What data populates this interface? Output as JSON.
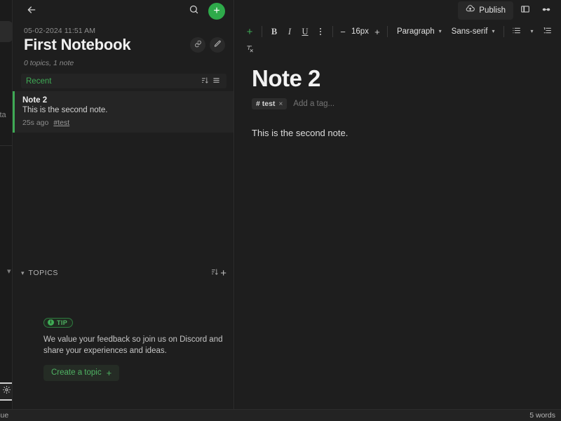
{
  "app_rail": {
    "beta_label": "Beta",
    "settings_icon": "gear-icon",
    "collapse_icon": "chevron-down-icon"
  },
  "list_panel": {
    "back_icon": "arrow-left-icon",
    "search_icon": "search-icon",
    "add_icon": "plus-icon",
    "notebook": {
      "date": "05-02-2024 11:51 AM",
      "title": "First Notebook",
      "meta": "0 topics, 1 note",
      "link_icon": "link-icon",
      "edit_icon": "pencil-icon"
    },
    "recent": {
      "label": "Recent",
      "sort_icon": "sort-descending-icon",
      "view_icon": "list-view-icon"
    },
    "notes": [
      {
        "title": "Note 2",
        "snippet": "This is the second note.",
        "age": "25s ago",
        "tag": "#test"
      }
    ],
    "topics": {
      "label": "TOPICS",
      "chevron_icon": "chevron-down-icon",
      "sort_icon": "sort-descending-icon",
      "add_icon": "plus-icon"
    },
    "tip": {
      "badge": "TIP",
      "badge_mark": "i",
      "text": "We value your feedback so join us on Discord and share your experiences and ideas.",
      "button_label": "Create a topic",
      "button_icon": "plus-icon"
    }
  },
  "editor": {
    "topbar": {
      "publish_label": "Publish",
      "publish_icon": "cloud-upload-icon",
      "split_view_icon": "split-view-icon",
      "reading_mode_icon": "glasses-icon"
    },
    "toolbar": {
      "insert_label": "+",
      "bold_label": "B",
      "italic_label": "I",
      "underline_label": "U",
      "more_icon": "more-vertical-icon",
      "size_decrease": "−",
      "size_value": "16px",
      "size_increase": "+",
      "block_type": "Paragraph",
      "font_family": "Sans-serif",
      "bullet_list_icon": "bulleted-list-icon",
      "list_caret_icon": "chevron-down-icon",
      "ordered_list_icon": "ordered-list-icon",
      "clear_format_icon": "clear-formatting-icon"
    },
    "document": {
      "title": "Note 2",
      "tag": "# test",
      "tag_remove": "×",
      "tag_placeholder": "Add a tag...",
      "body": "This is the second note."
    }
  },
  "status_bar": {
    "left_text": "ssue",
    "right_text": "5 words"
  },
  "colors": {
    "accent_green": "#2eaa4a",
    "accent_green_text": "#3faa55",
    "panel_bg": "#1e1e1e",
    "app_bg": "#1b1b1b",
    "card_bg": "#252525"
  }
}
